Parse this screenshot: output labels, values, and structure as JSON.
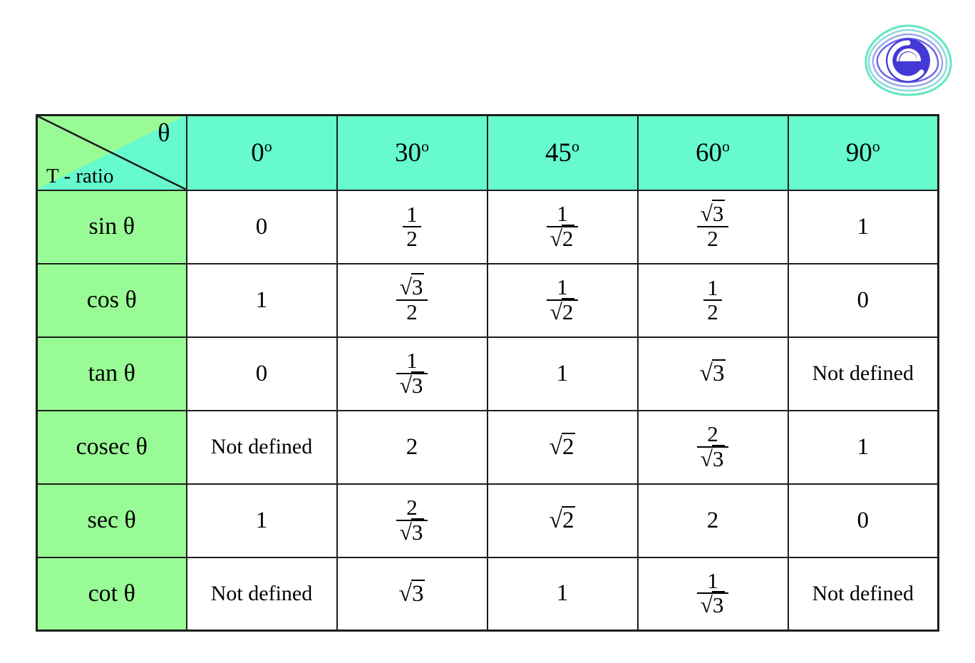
{
  "logo": {
    "name": "e-spiral-logo",
    "colors": {
      "core": "#4338d6",
      "ring_mid": "#6f63e8",
      "ring_outer": "#8ad9e0",
      "ring_edge": "#5fe8bd"
    }
  },
  "table": {
    "corner": {
      "top_right_label": "θ",
      "bottom_left_label": "T - ratio"
    },
    "angle_headers": [
      {
        "value": "0",
        "degree": "o"
      },
      {
        "value": "30",
        "degree": "o"
      },
      {
        "value": "45",
        "degree": "o"
      },
      {
        "value": "60",
        "degree": "o"
      },
      {
        "value": "90",
        "degree": "o"
      }
    ],
    "colors": {
      "header_teal": "#66FACC",
      "label_green": "#99FB95",
      "border": "#1d1d1d",
      "cell_white": "#ffffff"
    },
    "rows": [
      {
        "label": "sin θ",
        "cells": [
          {
            "kind": "plain",
            "text": "0"
          },
          {
            "kind": "frac",
            "num": "1",
            "den": "2"
          },
          {
            "kind": "frac",
            "num": "1",
            "den": "√2"
          },
          {
            "kind": "frac",
            "num": "√3",
            "den": "2"
          },
          {
            "kind": "plain",
            "text": "1"
          }
        ]
      },
      {
        "label": "cos θ",
        "cells": [
          {
            "kind": "plain",
            "text": "1"
          },
          {
            "kind": "frac",
            "num": "√3",
            "den": "2"
          },
          {
            "kind": "frac",
            "num": "1",
            "den": "√2"
          },
          {
            "kind": "frac",
            "num": "1",
            "den": "2"
          },
          {
            "kind": "plain",
            "text": "0"
          }
        ]
      },
      {
        "label": "tan θ",
        "cells": [
          {
            "kind": "plain",
            "text": "0"
          },
          {
            "kind": "frac",
            "num": "1",
            "den": "√3"
          },
          {
            "kind": "plain",
            "text": "1"
          },
          {
            "kind": "sqrt",
            "text": "3"
          },
          {
            "kind": "notdefined",
            "text": "Not defined"
          }
        ]
      },
      {
        "label": "cosec θ",
        "cells": [
          {
            "kind": "notdefined",
            "text": "Not defined"
          },
          {
            "kind": "plain",
            "text": "2"
          },
          {
            "kind": "sqrt",
            "text": "2"
          },
          {
            "kind": "frac",
            "num": "2",
            "den": "√3"
          },
          {
            "kind": "plain",
            "text": "1"
          }
        ]
      },
      {
        "label": "sec θ",
        "cells": [
          {
            "kind": "plain",
            "text": "1"
          },
          {
            "kind": "frac",
            "num": "2",
            "den": "√3"
          },
          {
            "kind": "sqrt",
            "text": "2"
          },
          {
            "kind": "plain",
            "text": "2"
          },
          {
            "kind": "plain",
            "text": "0"
          }
        ]
      },
      {
        "label": "cot θ",
        "cells": [
          {
            "kind": "notdefined",
            "text": "Not defined"
          },
          {
            "kind": "sqrt",
            "text": "3"
          },
          {
            "kind": "plain",
            "text": "1"
          },
          {
            "kind": "frac",
            "num": "1",
            "den": "√3"
          },
          {
            "kind": "notdefined",
            "text": "Not defined"
          }
        ]
      }
    ]
  }
}
